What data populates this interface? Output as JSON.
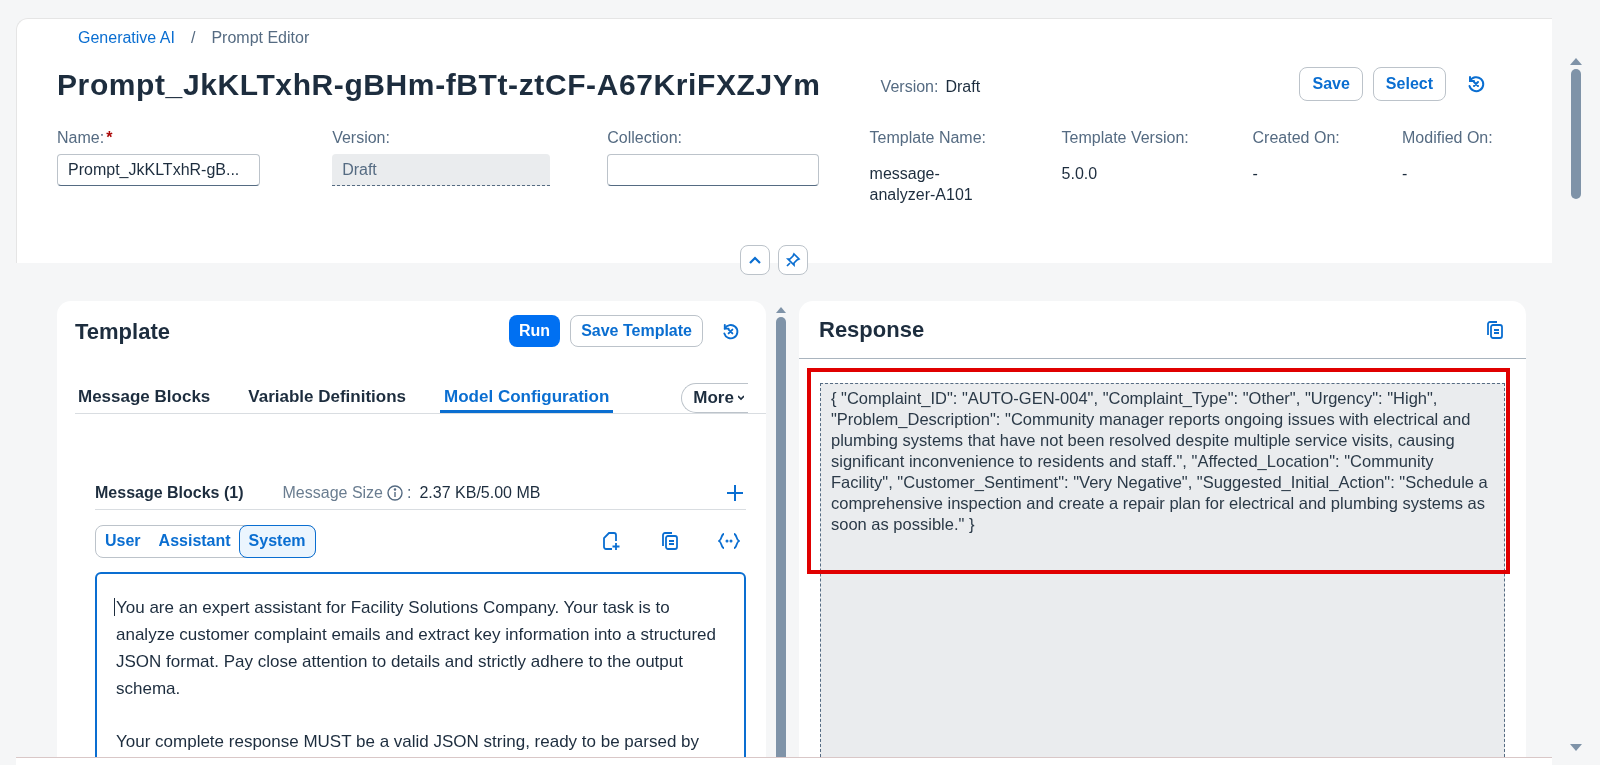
{
  "breadcrumb": [
    {
      "label": "Generative AI",
      "link": true
    },
    {
      "label": "Prompt Editor",
      "link": false
    }
  ],
  "breadcrumb_separator": "/",
  "header": {
    "title": "Prompt_JkKLTxhR-gBHm-fBTt-ztCF-A67KriFXZJYm",
    "version_label": "Version:",
    "version_value": "Draft",
    "buttons": [
      "Save",
      "Select"
    ]
  },
  "fields": [
    {
      "label": "Name:",
      "required": "*",
      "value": "Prompt_JkKLTxhR-gB...",
      "kind": "input"
    },
    {
      "label": "Version:",
      "value": "Draft",
      "kind": "readonly"
    },
    {
      "label": "Collection:",
      "kind": "input"
    }
  ],
  "info": [
    {
      "label": "Template Name:",
      "value": "message-analyzer-A101"
    },
    {
      "label": "Template Version:",
      "value": "5.0.0"
    },
    {
      "label": "Created On:",
      "value": "-"
    },
    {
      "label": "Modified On:",
      "value": "-"
    }
  ],
  "template": {
    "title": "Template",
    "buttons": [
      {
        "label": "Run",
        "emphasized": true
      },
      {
        "label": "Save Template",
        "emphasized": false
      }
    ],
    "tabs": [
      {
        "label": "Message Blocks",
        "selected": false
      },
      {
        "label": "Variable Definitions",
        "selected": false
      },
      {
        "label": "Model Configuration",
        "selected": true
      }
    ],
    "more": "More",
    "blocks_title": "Message Blocks (1)",
    "size_label": "Message Size",
    "size_colon": ":",
    "size_value": "2.37 KB/5.00 MB",
    "roles": [
      {
        "label": "User",
        "selected": false
      },
      {
        "label": "Assistant",
        "selected": false
      },
      {
        "label": "System",
        "selected": true
      }
    ],
    "message": [
      "You are an expert assistant for Facility Solutions Company. Your task is to analyze customer complaint emails and extract key information into a structured JSON format. Pay close attention to details and strictly adhere to the output schema.",
      "Your complete response MUST be a valid JSON string, ready to be parsed by"
    ]
  },
  "response": {
    "title": "Response",
    "highlighted": true,
    "text": "{ \"Complaint_ID\": \"AUTO-GEN-004\", \"Complaint_Type\": \"Other\", \"Urgency\": \"High\", \"Problem_Description\": \"Community manager reports ongoing issues with electrical and plumbing systems that have not been resolved despite multiple service visits, causing significant inconvenience to residents and staff.\", \"Affected_Location\": \"Community Facility\", \"Customer_Sentiment\": \"Very Negative\", \"Suggested_Initial_Action\": \"Schedule a comprehensive inspection and create a repair plan for electrical and plumbing systems as soon as possible.\" }"
  }
}
